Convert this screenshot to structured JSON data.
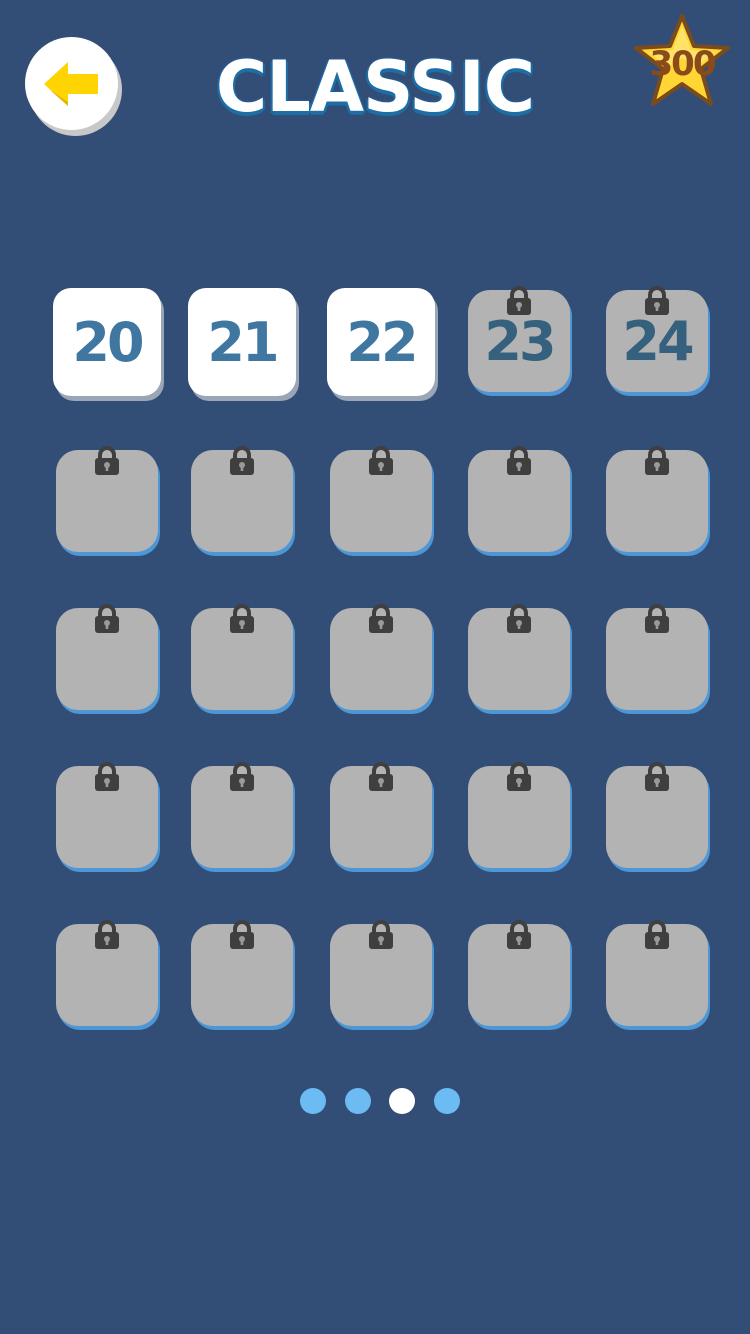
{
  "header": {
    "title": "CLASSIC",
    "back_icon": "back-arrow-icon",
    "star_icon": "star-icon",
    "star_count": "300"
  },
  "levels": [
    {
      "label": "20",
      "locked": false
    },
    {
      "label": "21",
      "locked": false
    },
    {
      "label": "22",
      "locked": false
    },
    {
      "label": "23",
      "locked": true
    },
    {
      "label": "24",
      "locked": true
    },
    {
      "label": "",
      "locked": true
    },
    {
      "label": "",
      "locked": true
    },
    {
      "label": "",
      "locked": true
    },
    {
      "label": "",
      "locked": true
    },
    {
      "label": "",
      "locked": true
    },
    {
      "label": "",
      "locked": true
    },
    {
      "label": "",
      "locked": true
    },
    {
      "label": "",
      "locked": true
    },
    {
      "label": "",
      "locked": true
    },
    {
      "label": "",
      "locked": true
    },
    {
      "label": "",
      "locked": true
    },
    {
      "label": "",
      "locked": true
    },
    {
      "label": "",
      "locked": true
    },
    {
      "label": "",
      "locked": true
    },
    {
      "label": "",
      "locked": true
    },
    {
      "label": "",
      "locked": true
    },
    {
      "label": "",
      "locked": true
    },
    {
      "label": "",
      "locked": true
    },
    {
      "label": "",
      "locked": true
    },
    {
      "label": "",
      "locked": true
    }
  ],
  "pagination": {
    "pages": 4,
    "active": 3
  },
  "colors": {
    "background": "#324d76",
    "tile_open": "#ffffff",
    "tile_locked": "#b3b3b3",
    "number": "#3f77a0",
    "dot": "#6cbbf2",
    "dot_active": "#ffffff",
    "arrow": "#ffd400",
    "star": "#ffd633"
  }
}
